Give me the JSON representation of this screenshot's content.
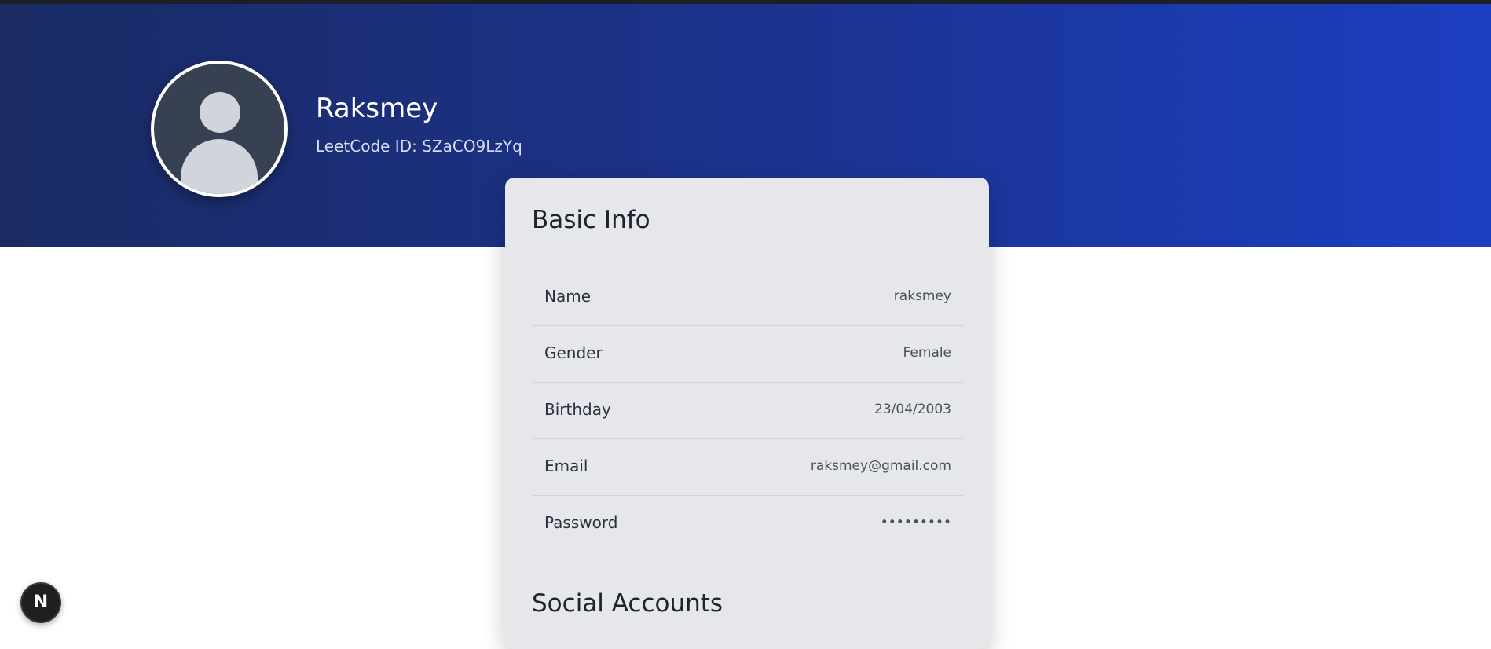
{
  "profile": {
    "name": "Raksmey",
    "leetcode_id": "LeetCode ID: SZaCO9LzYq"
  },
  "basic_info": {
    "title": "Basic Info",
    "rows": [
      {
        "label": "Name",
        "value": "raksmey"
      },
      {
        "label": "Gender",
        "value": "Female"
      },
      {
        "label": "Birthday",
        "value": "23/04/2003"
      },
      {
        "label": "Email",
        "value": "raksmey@gmail.com"
      },
      {
        "label": "Password",
        "value": "•••••••••"
      }
    ]
  },
  "social_accounts": {
    "title": "Social Accounts"
  },
  "dev_badge": {
    "label": "N"
  },
  "colors": {
    "hero_start": "#1a2b63",
    "hero_end": "#1c3fc2",
    "card_bg": "#e5e7eb"
  }
}
